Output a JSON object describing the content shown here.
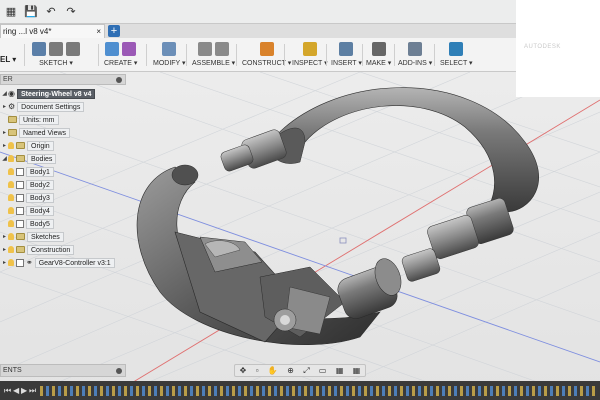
{
  "quick_access": {
    "icons": [
      "grid-icon",
      "save-icon",
      "undo-icon",
      "redo-icon"
    ],
    "glyphs": [
      "▦",
      "💾",
      "↶",
      "↷"
    ]
  },
  "document_tab": {
    "title": "ring ...l v8 v4*",
    "close": "×",
    "new_tab": "+"
  },
  "toolbar": {
    "mode": "EL ▾",
    "groups": [
      {
        "label": "SKETCH ▾",
        "colors": [
          "#5b7fa8",
          "#7a7a7a",
          "#7a7a7a"
        ]
      },
      {
        "label": "CREATE ▾",
        "colors": [
          "#4f8fd0",
          "#9b59b6"
        ]
      },
      {
        "label": "MODIFY ▾",
        "colors": [
          "#6c8fb8"
        ]
      },
      {
        "label": "ASSEMBLE ▾",
        "colors": [
          "#8a8a8a",
          "#8a8a8a"
        ]
      },
      {
        "label": "CONSTRUCT ▾",
        "colors": [
          "#d9822b"
        ]
      },
      {
        "label": "INSPECT ▾",
        "colors": [
          "#d4a62a"
        ]
      },
      {
        "label": "INSERT ▾",
        "colors": [
          "#5d7fa3"
        ]
      },
      {
        "label": "MAKE ▾",
        "colors": [
          "#666666"
        ]
      },
      {
        "label": "ADD-INS ▾",
        "colors": [
          "#6d7f94"
        ]
      },
      {
        "label": "SELECT ▾",
        "colors": [
          "#2f7fb7"
        ]
      }
    ]
  },
  "browser": {
    "header": "ER",
    "root": "Steering-Wheel v8 v4",
    "items": [
      {
        "type": "gear",
        "label": "Document Settings"
      },
      {
        "type": "units",
        "label": "Units: mm"
      },
      {
        "type": "folder",
        "label": "Named Views"
      },
      {
        "type": "folder",
        "label": "Origin"
      },
      {
        "type": "folder",
        "label": "Bodies"
      },
      {
        "type": "body",
        "label": "Body1"
      },
      {
        "type": "body",
        "label": "Body2"
      },
      {
        "type": "body",
        "label": "Body3"
      },
      {
        "type": "body",
        "label": "Body4"
      },
      {
        "type": "body",
        "label": "Body5"
      },
      {
        "type": "folder",
        "label": "Sketches"
      },
      {
        "type": "folder",
        "label": "Construction"
      },
      {
        "type": "component",
        "label": "GearV8-Controller v3:1"
      }
    ]
  },
  "comments": {
    "label": "ENTS"
  },
  "nav_bar": {
    "glyphs": [
      "✥",
      "▫",
      "✋",
      "⊕",
      "⤢",
      "▭",
      "▦",
      "▦"
    ],
    "icons": [
      "orbit-icon",
      "look-at-icon",
      "pan-icon",
      "zoom-icon",
      "fit-icon",
      "display-settings-icon",
      "grid-settings-icon",
      "viewports-icon"
    ]
  },
  "timeline": {
    "controls": [
      "⏮",
      "◀",
      "▶",
      "⏭"
    ]
  },
  "logo": {
    "text": "AUTODESK"
  },
  "colors": {
    "metal": "#6e6e6e",
    "metal_dark": "#3e3e3e",
    "grid": "#cfd3d8",
    "axis_red": "#e07070",
    "axis_blue": "#7f8fe0"
  }
}
